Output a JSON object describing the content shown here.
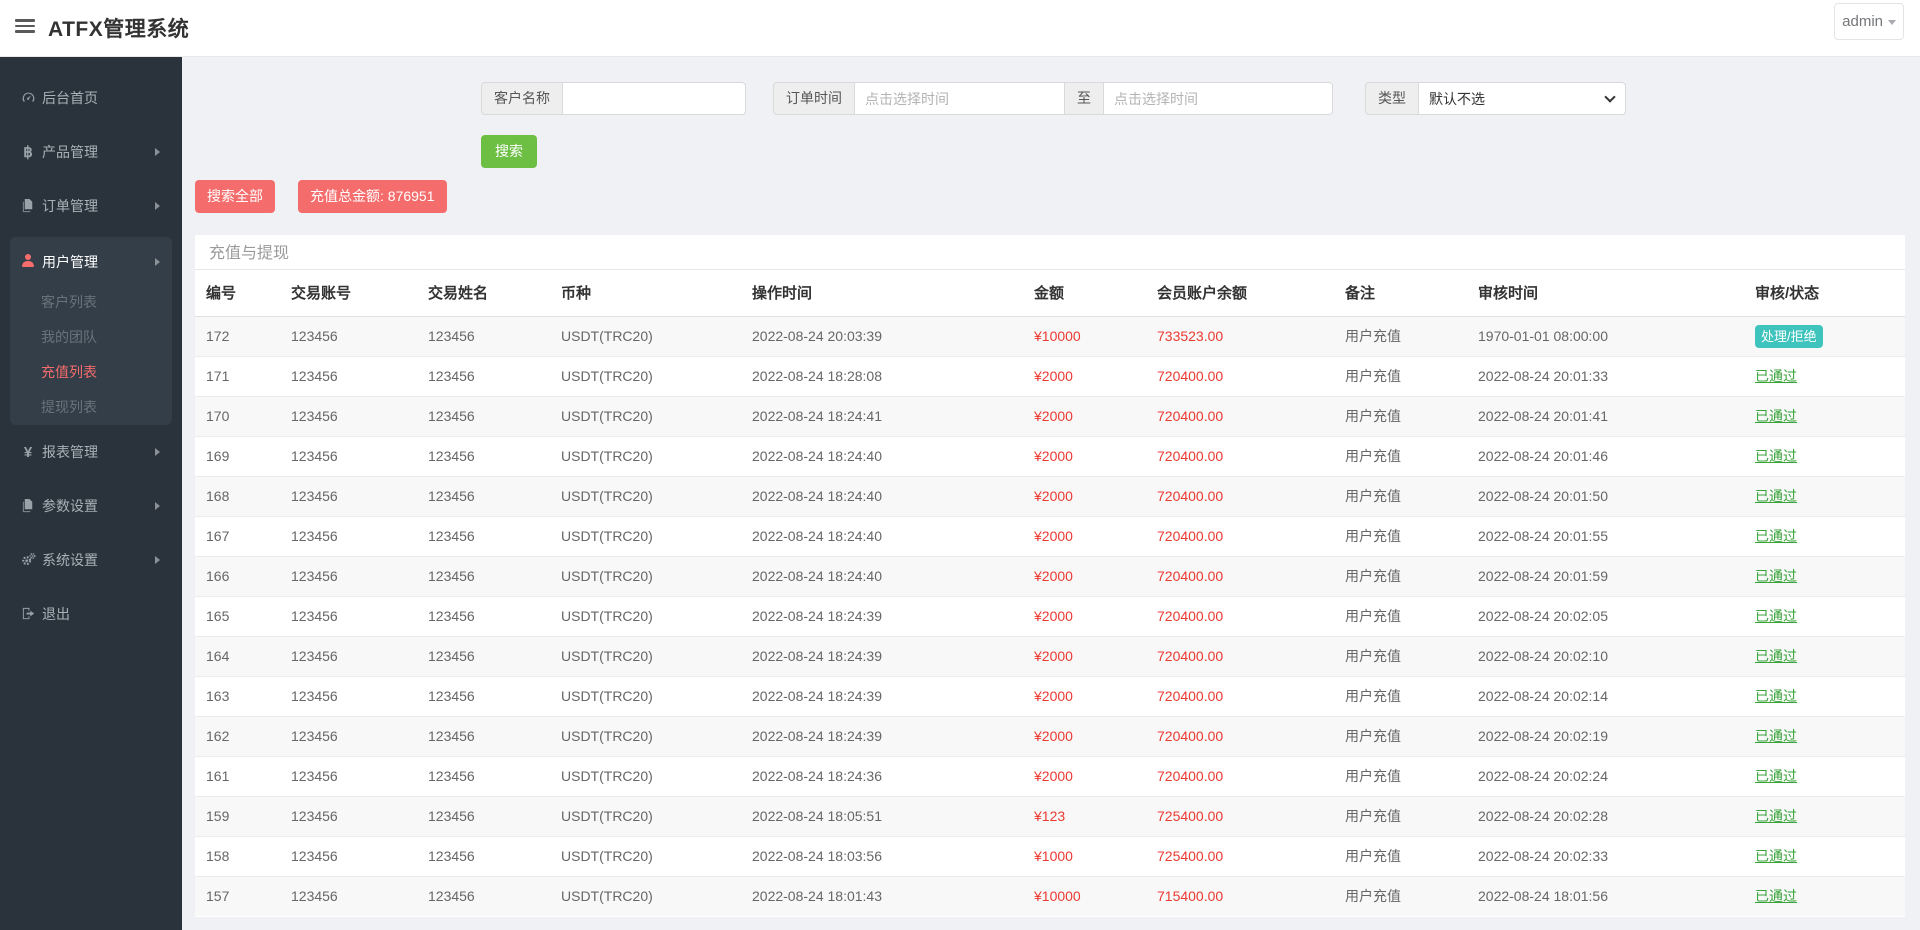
{
  "header": {
    "title": "ATFX管理系统",
    "user": "admin"
  },
  "sidebar": {
    "items": [
      {
        "key": "home",
        "label": "后台首页",
        "icon": "dashboard-icon",
        "arrow": false
      },
      {
        "key": "product",
        "label": "产品管理",
        "icon": "bitcoin-icon",
        "arrow": true
      },
      {
        "key": "order",
        "label": "订单管理",
        "icon": "files-icon",
        "arrow": true
      },
      {
        "key": "user",
        "label": "用户管理",
        "icon": "person-icon",
        "arrow": true,
        "active": true,
        "children": [
          {
            "label": "客户列表",
            "active": false
          },
          {
            "label": "我的团队",
            "active": false
          },
          {
            "label": "充值列表",
            "active": true
          },
          {
            "label": "提现列表",
            "active": false
          }
        ]
      },
      {
        "key": "report",
        "label": "报表管理",
        "icon": "yen-icon",
        "arrow": true
      },
      {
        "key": "param",
        "label": "参数设置",
        "icon": "files-icon",
        "arrow": true
      },
      {
        "key": "system",
        "label": "系统设置",
        "icon": "gears-icon",
        "arrow": true
      },
      {
        "key": "logout",
        "label": "退出",
        "icon": "logout-icon",
        "arrow": false
      }
    ]
  },
  "filters": {
    "customer_label": "客户名称",
    "customer_value": "",
    "time_label": "订单时间",
    "time_placeholder": "点击选择时间",
    "to_label": "至",
    "type_label": "类型",
    "type_value": "默认不选",
    "search_label": "搜索"
  },
  "actions": {
    "search_all_label": "搜索全部",
    "total_label": "充值总金额: 876951"
  },
  "table": {
    "title": "充值与提现",
    "columns": [
      "编号",
      "交易账号",
      "交易姓名",
      "币种",
      "操作时间",
      "金额",
      "会员账户余额",
      "备注",
      "审核时间",
      "审核/状态"
    ],
    "rows": [
      {
        "id": "172",
        "account": "123456",
        "name": "123456",
        "currency": "USDT(TRC20)",
        "time": "2022-08-24 20:03:39",
        "amount": "¥10000",
        "balance": "733523.00",
        "remark": "用户充值",
        "review_time": "1970-01-01 08:00:00",
        "status": "处理/拒绝",
        "status_type": "button"
      },
      {
        "id": "171",
        "account": "123456",
        "name": "123456",
        "currency": "USDT(TRC20)",
        "time": "2022-08-24 18:28:08",
        "amount": "¥2000",
        "balance": "720400.00",
        "remark": "用户充值",
        "review_time": "2022-08-24 20:01:33",
        "status": "已通过",
        "status_type": "link"
      },
      {
        "id": "170",
        "account": "123456",
        "name": "123456",
        "currency": "USDT(TRC20)",
        "time": "2022-08-24 18:24:41",
        "amount": "¥2000",
        "balance": "720400.00",
        "remark": "用户充值",
        "review_time": "2022-08-24 20:01:41",
        "status": "已通过",
        "status_type": "link"
      },
      {
        "id": "169",
        "account": "123456",
        "name": "123456",
        "currency": "USDT(TRC20)",
        "time": "2022-08-24 18:24:40",
        "amount": "¥2000",
        "balance": "720400.00",
        "remark": "用户充值",
        "review_time": "2022-08-24 20:01:46",
        "status": "已通过",
        "status_type": "link"
      },
      {
        "id": "168",
        "account": "123456",
        "name": "123456",
        "currency": "USDT(TRC20)",
        "time": "2022-08-24 18:24:40",
        "amount": "¥2000",
        "balance": "720400.00",
        "remark": "用户充值",
        "review_time": "2022-08-24 20:01:50",
        "status": "已通过",
        "status_type": "link"
      },
      {
        "id": "167",
        "account": "123456",
        "name": "123456",
        "currency": "USDT(TRC20)",
        "time": "2022-08-24 18:24:40",
        "amount": "¥2000",
        "balance": "720400.00",
        "remark": "用户充值",
        "review_time": "2022-08-24 20:01:55",
        "status": "已通过",
        "status_type": "link"
      },
      {
        "id": "166",
        "account": "123456",
        "name": "123456",
        "currency": "USDT(TRC20)",
        "time": "2022-08-24 18:24:40",
        "amount": "¥2000",
        "balance": "720400.00",
        "remark": "用户充值",
        "review_time": "2022-08-24 20:01:59",
        "status": "已通过",
        "status_type": "link"
      },
      {
        "id": "165",
        "account": "123456",
        "name": "123456",
        "currency": "USDT(TRC20)",
        "time": "2022-08-24 18:24:39",
        "amount": "¥2000",
        "balance": "720400.00",
        "remark": "用户充值",
        "review_time": "2022-08-24 20:02:05",
        "status": "已通过",
        "status_type": "link"
      },
      {
        "id": "164",
        "account": "123456",
        "name": "123456",
        "currency": "USDT(TRC20)",
        "time": "2022-08-24 18:24:39",
        "amount": "¥2000",
        "balance": "720400.00",
        "remark": "用户充值",
        "review_time": "2022-08-24 20:02:10",
        "status": "已通过",
        "status_type": "link"
      },
      {
        "id": "163",
        "account": "123456",
        "name": "123456",
        "currency": "USDT(TRC20)",
        "time": "2022-08-24 18:24:39",
        "amount": "¥2000",
        "balance": "720400.00",
        "remark": "用户充值",
        "review_time": "2022-08-24 20:02:14",
        "status": "已通过",
        "status_type": "link"
      },
      {
        "id": "162",
        "account": "123456",
        "name": "123456",
        "currency": "USDT(TRC20)",
        "time": "2022-08-24 18:24:39",
        "amount": "¥2000",
        "balance": "720400.00",
        "remark": "用户充值",
        "review_time": "2022-08-24 20:02:19",
        "status": "已通过",
        "status_type": "link"
      },
      {
        "id": "161",
        "account": "123456",
        "name": "123456",
        "currency": "USDT(TRC20)",
        "time": "2022-08-24 18:24:36",
        "amount": "¥2000",
        "balance": "720400.00",
        "remark": "用户充值",
        "review_time": "2022-08-24 20:02:24",
        "status": "已通过",
        "status_type": "link"
      },
      {
        "id": "159",
        "account": "123456",
        "name": "123456",
        "currency": "USDT(TRC20)",
        "time": "2022-08-24 18:05:51",
        "amount": "¥123",
        "balance": "725400.00",
        "remark": "用户充值",
        "review_time": "2022-08-24 20:02:28",
        "status": "已通过",
        "status_type": "link"
      },
      {
        "id": "158",
        "account": "123456",
        "name": "123456",
        "currency": "USDT(TRC20)",
        "time": "2022-08-24 18:03:56",
        "amount": "¥1000",
        "balance": "725400.00",
        "remark": "用户充值",
        "review_time": "2022-08-24 20:02:33",
        "status": "已通过",
        "status_type": "link"
      },
      {
        "id": "157",
        "account": "123456",
        "name": "123456",
        "currency": "USDT(TRC20)",
        "time": "2022-08-24 18:01:43",
        "amount": "¥10000",
        "balance": "715400.00",
        "remark": "用户充值",
        "review_time": "2022-08-24 18:01:56",
        "status": "已通过",
        "status_type": "link"
      }
    ]
  }
}
